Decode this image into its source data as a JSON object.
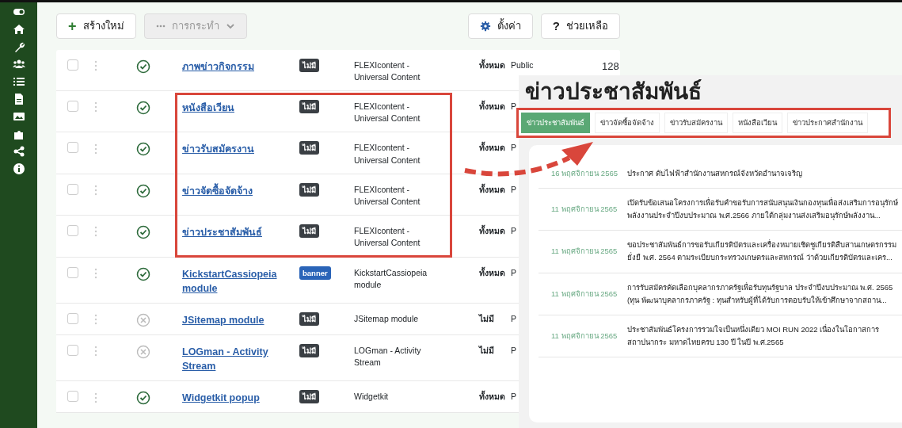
{
  "toolbar": {
    "new_button": {
      "label": "สร้างใหม่",
      "icon": "+"
    },
    "actions_dropdown": {
      "label": "การกระทำ",
      "disabled": true
    },
    "options_button": {
      "label": "ตั้งค่า"
    },
    "help_button": {
      "label": "ช่วยเหลือ",
      "icon": "?"
    }
  },
  "rows": [
    {
      "title": "ภาพข่าวกิจกรรม",
      "published": true,
      "badge": {
        "label": "ไม่มี",
        "kind": "none"
      },
      "type": "FLEXIcontent - Universal Content",
      "column_7": "ทั้งหมด",
      "column_8": "Public",
      "column_9": "128",
      "highlighted": false,
      "checked": false
    },
    {
      "title": "หนังสือเวียน",
      "published": true,
      "badge": {
        "label": "ไม่มี",
        "kind": "none"
      },
      "type": "FLEXIcontent - Universal Content",
      "column_7": "ทั้งหมด",
      "column_8": "P",
      "highlighted": true,
      "checked": false
    },
    {
      "title": "ข่าวรับสมัครงาน",
      "published": true,
      "badge": {
        "label": "ไม่มี",
        "kind": "none"
      },
      "type": "FLEXIcontent - Universal Content",
      "column_7": "ทั้งหมด",
      "column_8": "P",
      "highlighted": true,
      "checked": false
    },
    {
      "title": "ข่าวจัดซื้อจัดจ้าง",
      "published": true,
      "badge": {
        "label": "ไม่มี",
        "kind": "none"
      },
      "type": "FLEXIcontent - Universal Content",
      "column_7": "ทั้งหมด",
      "column_8": "P",
      "highlighted": true,
      "checked": false
    },
    {
      "title": "ข่าวประชาสัมพันธ์",
      "published": true,
      "badge": {
        "label": "ไม่มี",
        "kind": "none"
      },
      "type": "FLEXIcontent - Universal Content",
      "column_7": "ทั้งหมด",
      "column_8": "P",
      "highlighted": true,
      "checked": false
    },
    {
      "title": "KickstartCassiopeia module",
      "published": true,
      "badge": {
        "label": "banner",
        "kind": "position"
      },
      "type": "KickstartCassiopeia module",
      "column_7": "ทั้งหมด",
      "column_8": "P",
      "highlighted": false,
      "checked": false
    },
    {
      "title": "JSitemap module",
      "published": false,
      "badge": {
        "label": "ไม่มี",
        "kind": "none"
      },
      "type": "JSitemap module",
      "column_7": "ไม่มี",
      "column_8": "P",
      "highlighted": false,
      "checked": false
    },
    {
      "title": "LOGman - Activity Stream",
      "published": false,
      "badge": {
        "label": "ไม่มี",
        "kind": "none"
      },
      "type": "LOGman - Activity Stream",
      "column_7": "ไม่มี",
      "column_8": "P",
      "highlighted": false,
      "checked": false
    },
    {
      "title": "Widgetkit popup",
      "published": true,
      "badge": {
        "label": "ไม่มี",
        "kind": "none"
      },
      "type": "Widgetkit",
      "column_7": "ทั้งหมด",
      "column_8": "P",
      "highlighted": false,
      "checked": false
    }
  ],
  "website_preview": {
    "heading": "ข่าวประชาสัมพันธ์",
    "tabs": [
      {
        "label": "ข่าวประชาสัมพันธ์",
        "selected": true
      },
      {
        "label": "ข่าวจัดซื้อจัดจ้าง",
        "selected": false
      },
      {
        "label": "ข่าวรับสมัครงาน",
        "selected": false
      },
      {
        "label": "หนังสือเวียน",
        "selected": false
      },
      {
        "label": "ข่าวประกาศสำนักงาน",
        "selected": false
      }
    ],
    "tabs_highlighted": true,
    "news": [
      {
        "date": "16 พฤศจิกายน 2565",
        "text": "ประกาศ ดับไฟฟ้าสำนักงานสหกรณ์จังหวัดอำนาจเจริญ"
      },
      {
        "date": "11 พฤศจิกายน 2565",
        "text": "เปิดรับข้อเสนอโครงการเพื่อรับคำขอรับการสนับสนุนเงินกองทุนเพื่อส่งเสริมการอนุรักษ์ พลังงานประจำปีงบประมาณ พ.ศ.2566 ภายใต้กลุ่มงานส่งเสริมอนุรักษ์พลังงาน..."
      },
      {
        "date": "11 พฤศจิกายน 2565",
        "text": "ขอประชาสัมพันธ์การขอรับเกียรติบัตรและเครื่องหมายเชิดชูเกียรติสืบสานเกษตรกรรมยั่งยื พ.ศ. 2564 ตามระเบียบกระทรวงเกษตรและสหกรณ์ ว่าด้วยเกียรติบัตรและเคร..."
      },
      {
        "date": "11 พฤศจิกายน 2565",
        "text": "การรับสมัครคัดเลือกบุคลากรภาครัฐเพื่อรับทุนรัฐบาล ประจำปีงบประมาณ พ.ศ. 2565 (ทุน พัฒนาบุคลากรภาครัฐ : ทุนสำหรับผู้ที่ได้รับการตอบรับให้เข้าศึกษาจากสถาน..."
      },
      {
        "date": "11 พฤศจิกายน 2565",
        "text": "ประชาสัมพันธ์โครงการรวมใจเป็นหนึ่งเดียว MOI RUN 2022 เนื่องในโอกาสการสถาปนากระ มหาดไทยครบ 130 ปี ในปี พ.ศ.2565"
      }
    ]
  }
}
